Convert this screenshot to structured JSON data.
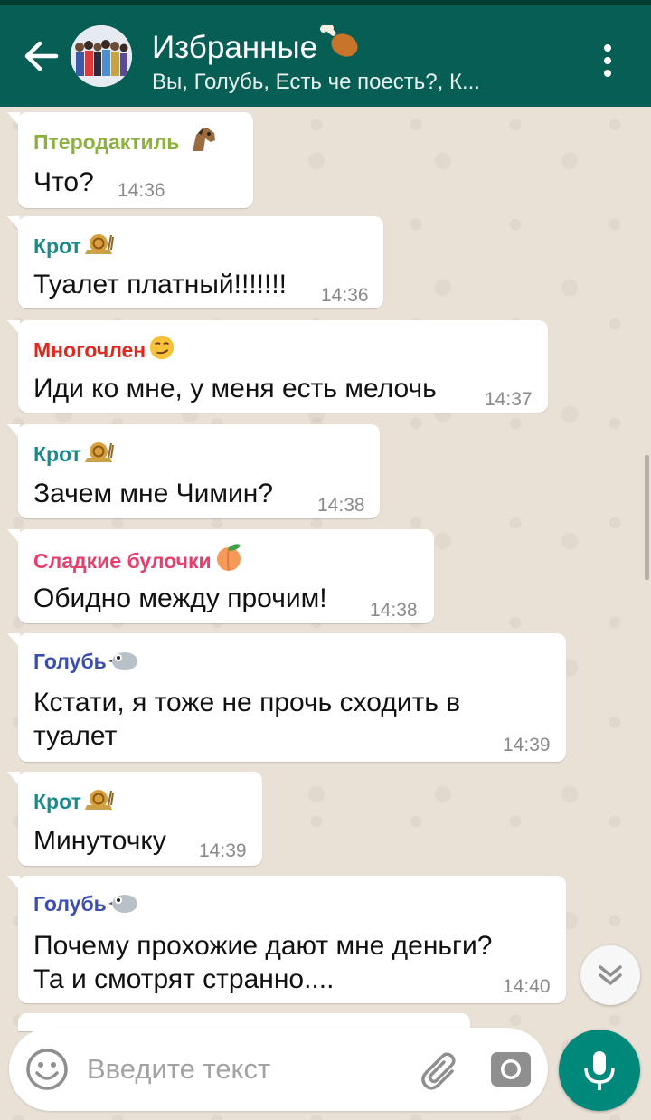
{
  "colors": {
    "header": "#075e54",
    "mic_button": "#00897b",
    "bubble": "#ffffff",
    "wallpaper": "#e9e1d6"
  },
  "header": {
    "title": "Избранные",
    "title_emoji_icon": "poultry-leg-icon",
    "subtitle": "Вы, Голубь, Есть че поесть?, К...",
    "back_icon": "arrow-left-icon",
    "menu_icon": "vertical-dots-icon"
  },
  "messages": [
    {
      "sender": "Птеродактиль",
      "sender_color": "#8cb13e",
      "sender_emoji_icon": "horse-face-icon",
      "lines": [
        "Что?"
      ],
      "time": "14:36"
    },
    {
      "sender": "Крот",
      "sender_color": "#1a8b8b",
      "sender_emoji_icon": "snail-icon",
      "lines": [
        "Туалет платный!!!!!!!"
      ],
      "time": "14:36"
    },
    {
      "sender": "Многочлен",
      "sender_color": "#e0281f",
      "sender_emoji_icon": "smirking-face-icon",
      "lines": [
        "Иди ко мне, у меня есть мелочь"
      ],
      "time": "14:37"
    },
    {
      "sender": "Крот",
      "sender_color": "#1a8b8b",
      "sender_emoji_icon": "snail-icon",
      "lines": [
        "Зачем мне Чимин?"
      ],
      "time": "14:38"
    },
    {
      "sender": "Сладкие булочки",
      "sender_color": "#e83e6c",
      "sender_emoji_icon": "peach-icon",
      "lines": [
        "Обидно между прочим!"
      ],
      "time": "14:38"
    },
    {
      "sender": "Голубь",
      "sender_color": "#3b4fb0",
      "sender_emoji_icon": "pigeon-icon",
      "lines": [
        "Кстати, я тоже не прочь сходить в",
        "туалет"
      ],
      "time": "14:39"
    },
    {
      "sender": "Крот",
      "sender_color": "#1a8b8b",
      "sender_emoji_icon": "snail-icon",
      "lines": [
        "Минуточку"
      ],
      "time": "14:39"
    },
    {
      "sender": "Голубь",
      "sender_color": "#3b4fb0",
      "sender_emoji_icon": "pigeon-icon",
      "lines": [
        "Почему прохожие дают мне деньги?",
        "Та и смотрят странно...."
      ],
      "time": "14:40"
    }
  ],
  "composer": {
    "placeholder": "Введите текст",
    "emoji_icon": "smiley-icon",
    "attach_icon": "paperclip-icon",
    "camera_icon": "camera-icon",
    "mic_icon": "microphone-icon"
  },
  "scroll_down_icon": "double-chevron-down-icon"
}
